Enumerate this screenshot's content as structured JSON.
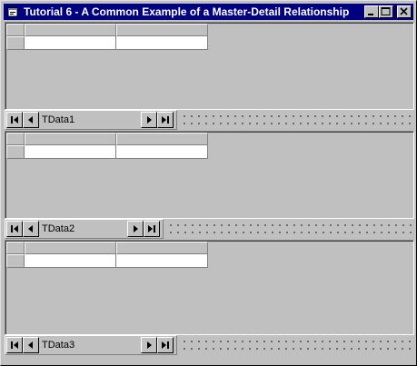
{
  "window": {
    "title": "Tutorial 6 - A Common Example of a Master-Detail Relationship",
    "controls": [
      "minimize-icon",
      "maximize-icon",
      "close-icon"
    ]
  },
  "panels": [
    {
      "data_control_caption": "TData1"
    },
    {
      "data_control_caption": "TData2"
    },
    {
      "data_control_caption": "TData3"
    }
  ],
  "nav_icons": [
    "move-first-icon",
    "move-previous-icon",
    "move-next-icon",
    "move-last-icon"
  ]
}
